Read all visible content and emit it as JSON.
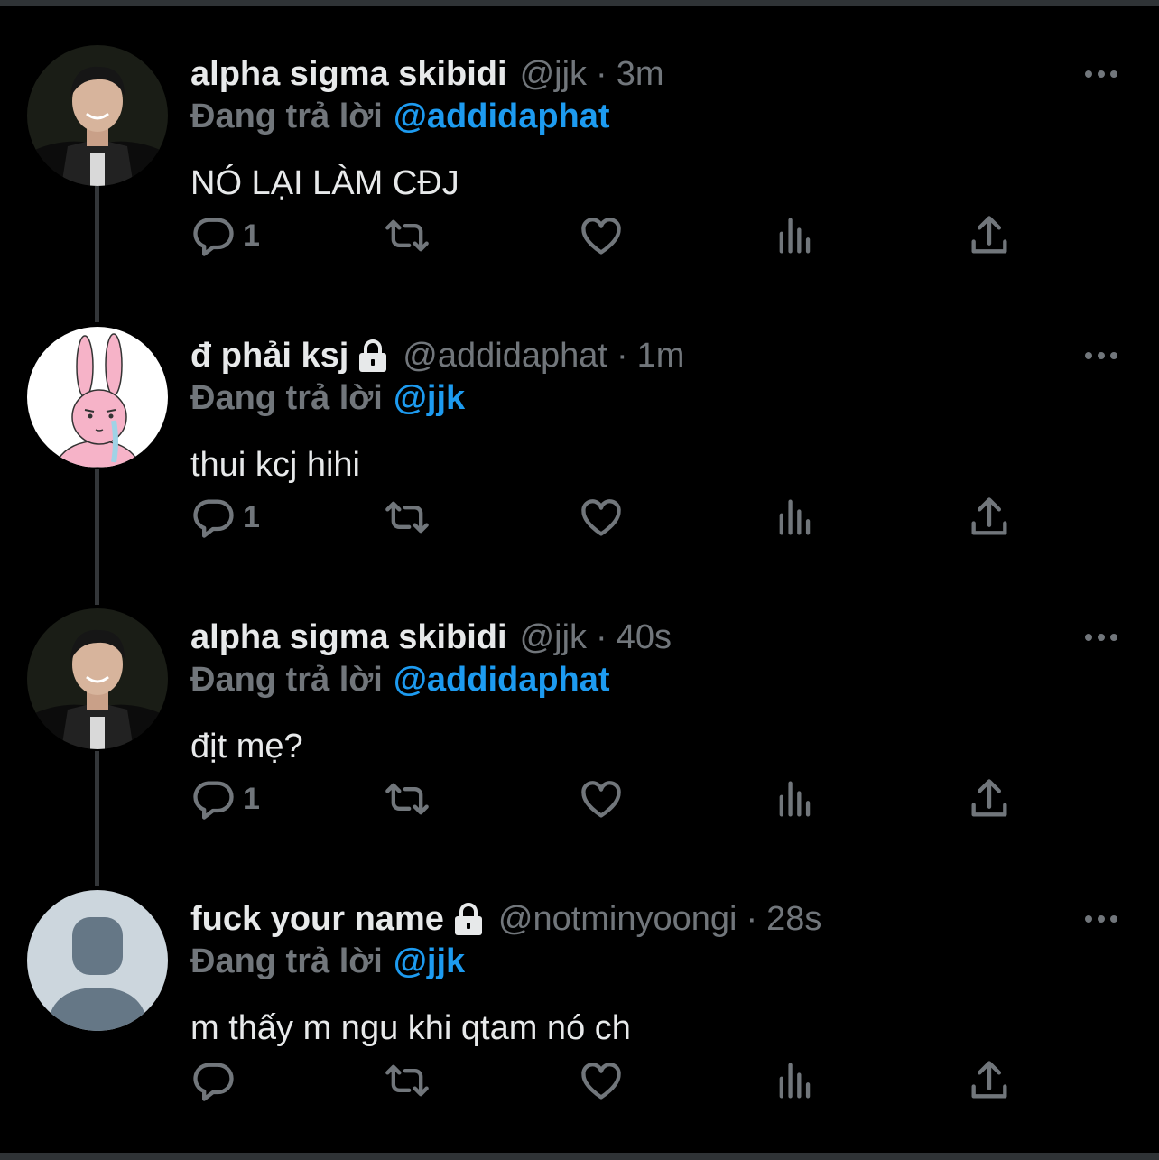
{
  "reply_prefix": "Đang trả lời",
  "separator": "·",
  "icons": {
    "more": "more-icon",
    "lock": "lock-icon",
    "reply": "reply-icon",
    "retweet": "retweet-icon",
    "like": "like-icon",
    "views": "views-icon",
    "share": "share-icon"
  },
  "colors": {
    "background": "#000000",
    "accent": "#1d9bf0",
    "muted": "#71767b",
    "text": "#e7e9ea"
  },
  "tweets": [
    {
      "name": "alpha sigma skibidi",
      "protected": false,
      "handle": "@jjk",
      "time": "3m",
      "reply_to": "@addidaphat",
      "text": "NÓ LẠI LÀM CĐJ",
      "reply_count": "1",
      "avatar": "photo"
    },
    {
      "name": "đ phải ksj",
      "protected": true,
      "handle": "@addidaphat",
      "time": "1m",
      "reply_to": "@jjk",
      "text": "thui kcj hihi",
      "reply_count": "1",
      "avatar": "bunny"
    },
    {
      "name": "alpha sigma skibidi",
      "protected": false,
      "handle": "@jjk",
      "time": "40s",
      "reply_to": "@addidaphat",
      "text": "địt mẹ?",
      "reply_count": "1",
      "avatar": "photo"
    },
    {
      "name": "fuck your name",
      "protected": true,
      "handle": "@notminyoongi",
      "time": "28s",
      "reply_to": "@jjk",
      "text": "m thấy m ngu khi qtam nó ch",
      "reply_count": "",
      "avatar": "default"
    }
  ]
}
